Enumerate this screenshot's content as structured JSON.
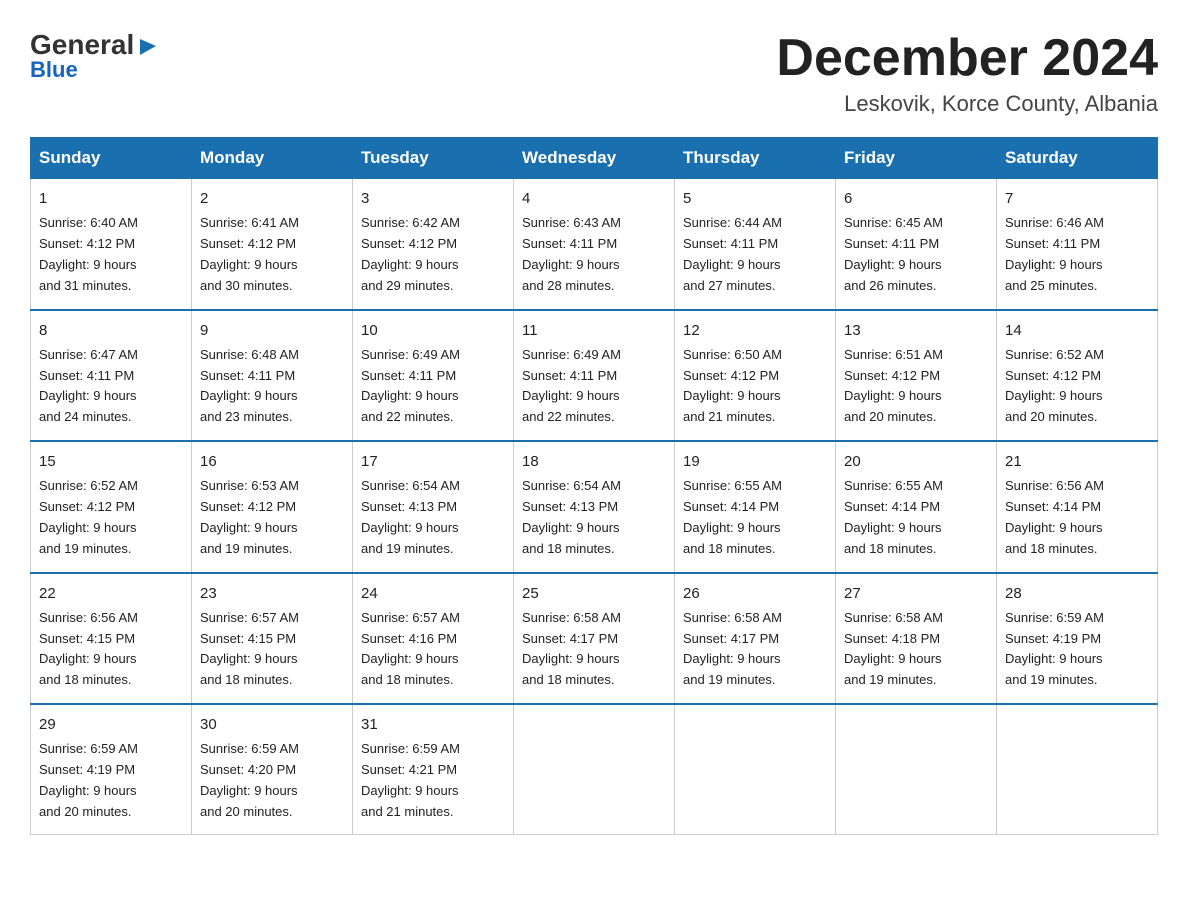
{
  "logo": {
    "line1": "General",
    "triangle": "▶",
    "line2": "Blue"
  },
  "title": "December 2024",
  "subtitle": "Leskovik, Korce County, Albania",
  "days_of_week": [
    "Sunday",
    "Monday",
    "Tuesday",
    "Wednesday",
    "Thursday",
    "Friday",
    "Saturday"
  ],
  "weeks": [
    [
      {
        "day": "1",
        "info": "Sunrise: 6:40 AM\nSunset: 4:12 PM\nDaylight: 9 hours\nand 31 minutes."
      },
      {
        "day": "2",
        "info": "Sunrise: 6:41 AM\nSunset: 4:12 PM\nDaylight: 9 hours\nand 30 minutes."
      },
      {
        "day": "3",
        "info": "Sunrise: 6:42 AM\nSunset: 4:12 PM\nDaylight: 9 hours\nand 29 minutes."
      },
      {
        "day": "4",
        "info": "Sunrise: 6:43 AM\nSunset: 4:11 PM\nDaylight: 9 hours\nand 28 minutes."
      },
      {
        "day": "5",
        "info": "Sunrise: 6:44 AM\nSunset: 4:11 PM\nDaylight: 9 hours\nand 27 minutes."
      },
      {
        "day": "6",
        "info": "Sunrise: 6:45 AM\nSunset: 4:11 PM\nDaylight: 9 hours\nand 26 minutes."
      },
      {
        "day": "7",
        "info": "Sunrise: 6:46 AM\nSunset: 4:11 PM\nDaylight: 9 hours\nand 25 minutes."
      }
    ],
    [
      {
        "day": "8",
        "info": "Sunrise: 6:47 AM\nSunset: 4:11 PM\nDaylight: 9 hours\nand 24 minutes."
      },
      {
        "day": "9",
        "info": "Sunrise: 6:48 AM\nSunset: 4:11 PM\nDaylight: 9 hours\nand 23 minutes."
      },
      {
        "day": "10",
        "info": "Sunrise: 6:49 AM\nSunset: 4:11 PM\nDaylight: 9 hours\nand 22 minutes."
      },
      {
        "day": "11",
        "info": "Sunrise: 6:49 AM\nSunset: 4:11 PM\nDaylight: 9 hours\nand 22 minutes."
      },
      {
        "day": "12",
        "info": "Sunrise: 6:50 AM\nSunset: 4:12 PM\nDaylight: 9 hours\nand 21 minutes."
      },
      {
        "day": "13",
        "info": "Sunrise: 6:51 AM\nSunset: 4:12 PM\nDaylight: 9 hours\nand 20 minutes."
      },
      {
        "day": "14",
        "info": "Sunrise: 6:52 AM\nSunset: 4:12 PM\nDaylight: 9 hours\nand 20 minutes."
      }
    ],
    [
      {
        "day": "15",
        "info": "Sunrise: 6:52 AM\nSunset: 4:12 PM\nDaylight: 9 hours\nand 19 minutes."
      },
      {
        "day": "16",
        "info": "Sunrise: 6:53 AM\nSunset: 4:12 PM\nDaylight: 9 hours\nand 19 minutes."
      },
      {
        "day": "17",
        "info": "Sunrise: 6:54 AM\nSunset: 4:13 PM\nDaylight: 9 hours\nand 19 minutes."
      },
      {
        "day": "18",
        "info": "Sunrise: 6:54 AM\nSunset: 4:13 PM\nDaylight: 9 hours\nand 18 minutes."
      },
      {
        "day": "19",
        "info": "Sunrise: 6:55 AM\nSunset: 4:14 PM\nDaylight: 9 hours\nand 18 minutes."
      },
      {
        "day": "20",
        "info": "Sunrise: 6:55 AM\nSunset: 4:14 PM\nDaylight: 9 hours\nand 18 minutes."
      },
      {
        "day": "21",
        "info": "Sunrise: 6:56 AM\nSunset: 4:14 PM\nDaylight: 9 hours\nand 18 minutes."
      }
    ],
    [
      {
        "day": "22",
        "info": "Sunrise: 6:56 AM\nSunset: 4:15 PM\nDaylight: 9 hours\nand 18 minutes."
      },
      {
        "day": "23",
        "info": "Sunrise: 6:57 AM\nSunset: 4:15 PM\nDaylight: 9 hours\nand 18 minutes."
      },
      {
        "day": "24",
        "info": "Sunrise: 6:57 AM\nSunset: 4:16 PM\nDaylight: 9 hours\nand 18 minutes."
      },
      {
        "day": "25",
        "info": "Sunrise: 6:58 AM\nSunset: 4:17 PM\nDaylight: 9 hours\nand 18 minutes."
      },
      {
        "day": "26",
        "info": "Sunrise: 6:58 AM\nSunset: 4:17 PM\nDaylight: 9 hours\nand 19 minutes."
      },
      {
        "day": "27",
        "info": "Sunrise: 6:58 AM\nSunset: 4:18 PM\nDaylight: 9 hours\nand 19 minutes."
      },
      {
        "day": "28",
        "info": "Sunrise: 6:59 AM\nSunset: 4:19 PM\nDaylight: 9 hours\nand 19 minutes."
      }
    ],
    [
      {
        "day": "29",
        "info": "Sunrise: 6:59 AM\nSunset: 4:19 PM\nDaylight: 9 hours\nand 20 minutes."
      },
      {
        "day": "30",
        "info": "Sunrise: 6:59 AM\nSunset: 4:20 PM\nDaylight: 9 hours\nand 20 minutes."
      },
      {
        "day": "31",
        "info": "Sunrise: 6:59 AM\nSunset: 4:21 PM\nDaylight: 9 hours\nand 21 minutes."
      },
      {
        "day": "",
        "info": ""
      },
      {
        "day": "",
        "info": ""
      },
      {
        "day": "",
        "info": ""
      },
      {
        "day": "",
        "info": ""
      }
    ]
  ]
}
